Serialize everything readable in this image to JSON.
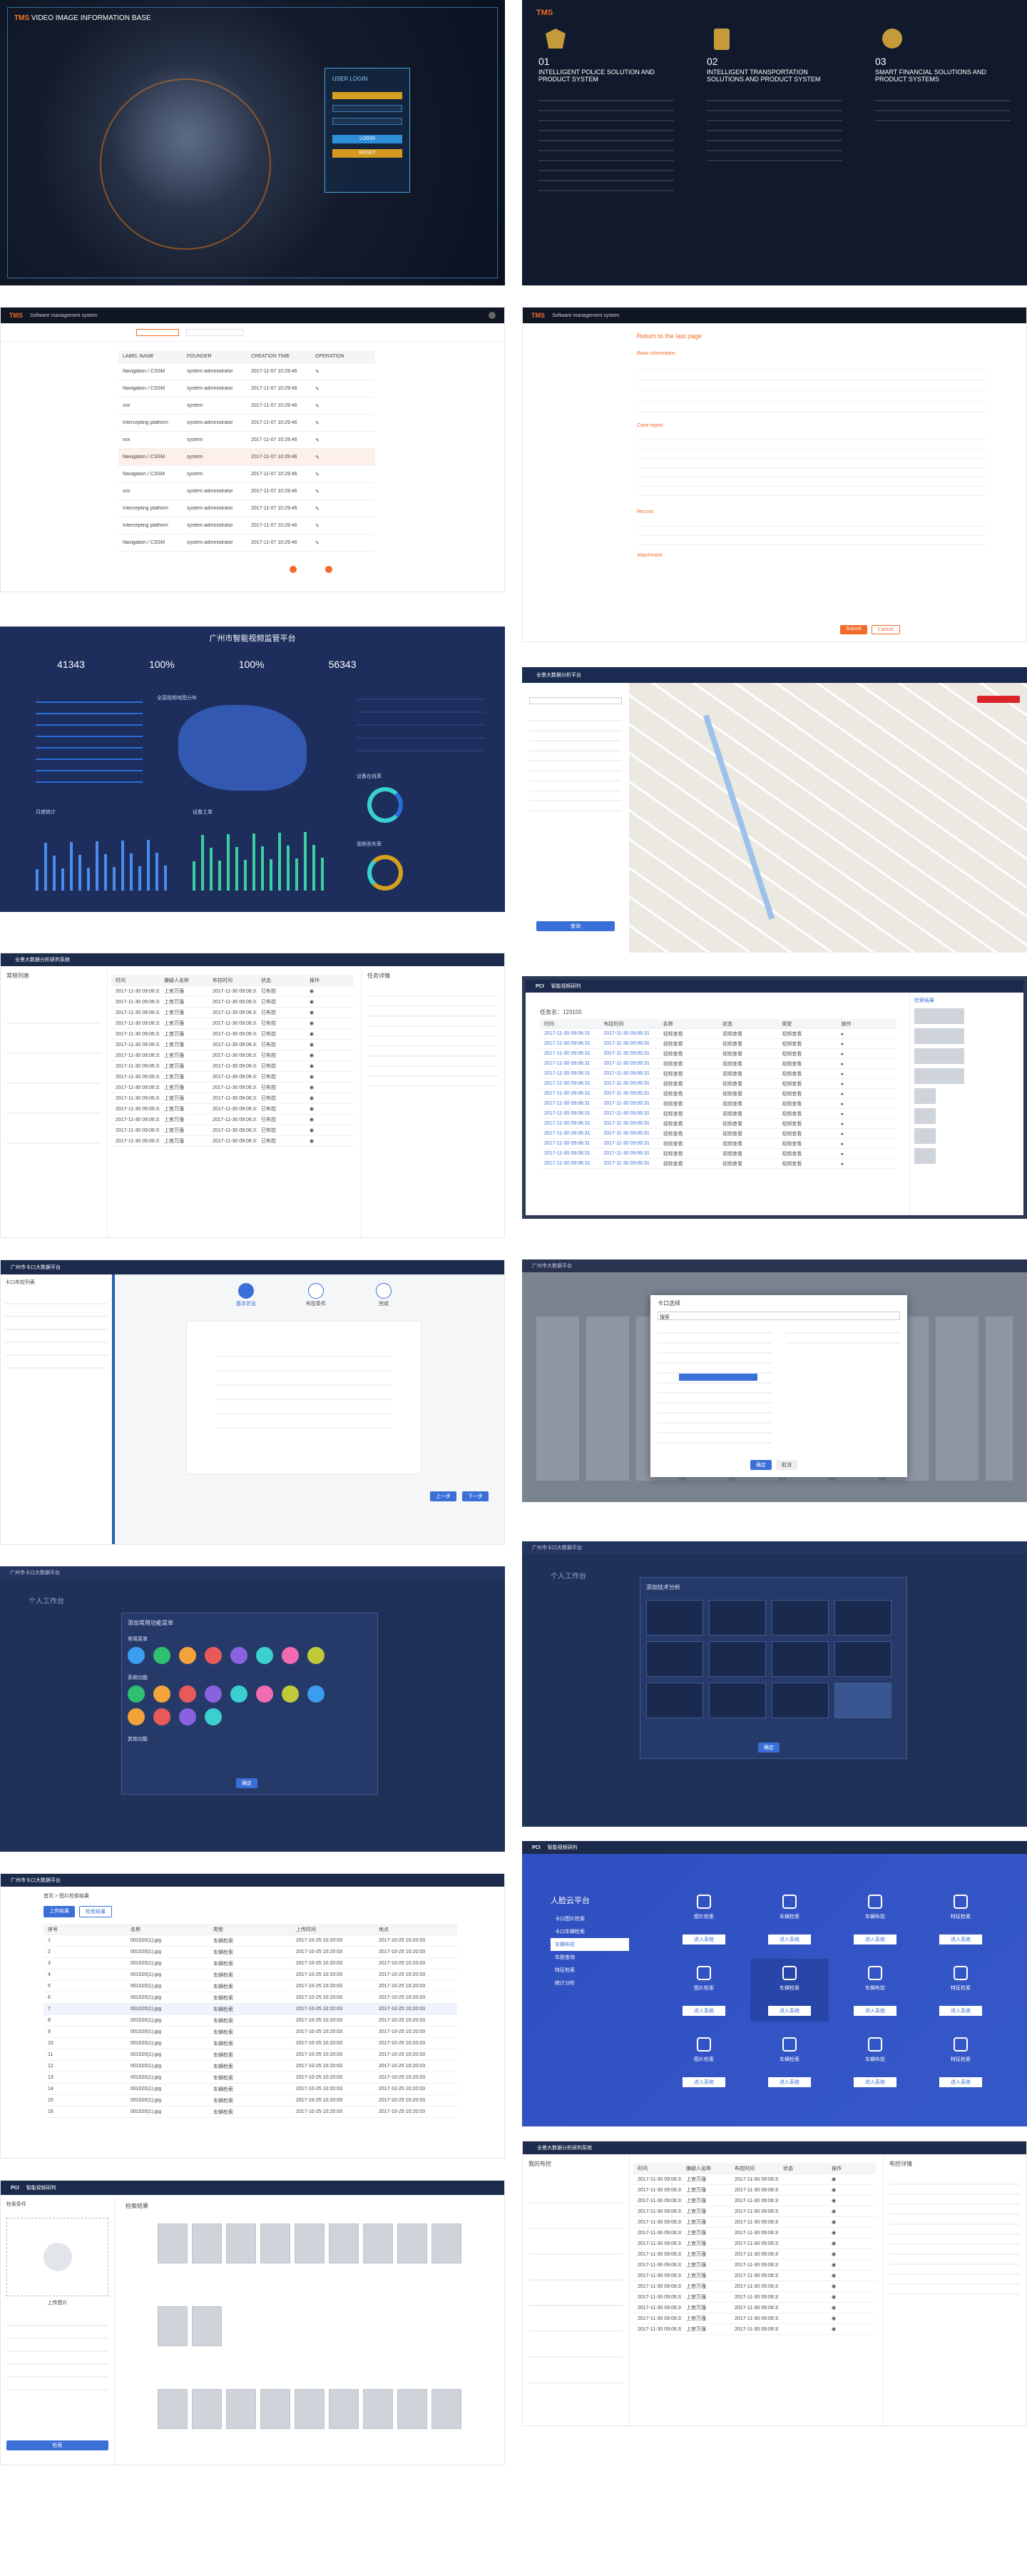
{
  "p1": {
    "brand": "TMS",
    "title": "VIDEO IMAGE INFORMATION BASE",
    "login_title": "USER LOGIN",
    "btn1": "LOGIN",
    "btn2": "RESET"
  },
  "p2": {
    "brand": "TMS",
    "num1": "01",
    "num2": "02",
    "num3": "03",
    "h1": "INTELLIGENT POLICE SOLUTION AND PRODUCT SYSTEM",
    "h2": "INTELLIGENT TRANSPORTATION SOLUTIONS AND PRODUCT SYSTEM",
    "h3": "SMART FINANCIAL SOLUTIONS AND PRODUCT SYSTEMS"
  },
  "p3": {
    "brand": "TMS",
    "app": "Software management system",
    "cols": [
      "LABEL NAME",
      "FOUNDER",
      "CREATION TIME",
      "OPERATION"
    ],
    "rows": [
      [
        "Navigation / CSSM",
        "system administrator",
        "2017-11-07 10:29:46"
      ],
      [
        "Navigation / CSSM",
        "system administrator",
        "2017-11-07 10:29:46"
      ],
      [
        "xxx",
        "system",
        "2017-11-07 10:29:46"
      ],
      [
        "Intercepting platform",
        "system administrator",
        "2017-11-07 10:29:46"
      ],
      [
        "xxx",
        "system",
        "2017-11-07 10:29:46"
      ],
      [
        "Navigation / CSSM",
        "system",
        "2017-11-07 10:29:46"
      ],
      [
        "Navigation / CSSM",
        "system",
        "2017-11-07 10:29:46"
      ],
      [
        "xxx",
        "system administrator",
        "2017-11-07 10:29:46"
      ],
      [
        "Intercepting platform",
        "system administrator",
        "2017-11-07 10:29:46"
      ],
      [
        "Intercepting platform",
        "system administrator",
        "2017-11-07 10:29:46"
      ],
      [
        "Navigation / CSSM",
        "system administrator",
        "2017-11-07 10:29:46"
      ]
    ]
  },
  "p4": {
    "brand": "TMS",
    "app": "Software management system",
    "heading": "Return to the last page",
    "sec1": "Basic information",
    "sec2": "Case report",
    "sec3": "Record",
    "sec4": "Attachment",
    "btn1": "Submit",
    "btn2": "Cancel"
  },
  "p5": {
    "title": "广州市智能视频监管平台",
    "s1": "41343",
    "s2": "100%",
    "s3": "100%",
    "s4": "56343",
    "map": "全国视频地图分布",
    "chart1": "月度统计",
    "chart2": "设备工单",
    "pie1": "设备在线率",
    "pie2": "视频丢失率"
  },
  "p6": {
    "app": "全景大数据分析平台",
    "search": "搜索",
    "btn": "查询"
  },
  "p7": {
    "app": "全景大数据分析研判系统",
    "list_title": "常规列表",
    "panel": "任务详情",
    "cols": [
      "时间",
      "嫌疑人名称",
      "布控时间",
      "状态",
      "操作"
    ],
    "row_time": "2017-11-30 09:06:31",
    "row_name": "上官万强",
    "row_status": "已布控"
  },
  "p8": {
    "brand": "PCI",
    "app": "智能视频研判",
    "title": "任务名：123155",
    "cols": [
      "时间",
      "布控时间",
      "名称",
      "状态",
      "类型",
      "操作"
    ],
    "row_time": "2017-11-30 09:06:31",
    "row_name": "视频查看",
    "right_title": "检索结果"
  },
  "p9": {
    "app": "广州市卡口大数据平台",
    "step1": "基本信息",
    "step2": "布控条件",
    "step3": "完成",
    "side": "卡口布控列表",
    "btn1": "上一步",
    "btn2": "下一步"
  },
  "p10": {
    "app": "广州市大数据平台",
    "modal_title": "卡口选择",
    "search": "搜索",
    "ok": "确定",
    "cancel": "取消"
  },
  "p11": {
    "app": "广州市卡口大数据平台",
    "bg": "个人工作台",
    "modal_title": "添加常用功能菜单",
    "g1": "常用菜单",
    "g2": "系统功能",
    "g3": "其他功能",
    "ok": "确定"
  },
  "p12": {
    "app": "广州市卡口大数据平台",
    "bg": "个人工作台",
    "modal_title": "添加技术分析",
    "ok": "确定"
  },
  "p13": {
    "app": "广州市卡口大数据平台",
    "crumb": "首页 > 图片检索结果",
    "tab1": "上传结果",
    "tab2": "检索结果",
    "cols": [
      "序号",
      "名称",
      "类型",
      "上传时间",
      "地点"
    ],
    "fname": "001020(1).jpg",
    "ftype": "车辆检索",
    "ftime": "2017-10-25 10:20:03"
  },
  "p14": {
    "brand": "PCI",
    "app": "智能视频研判",
    "title": "人脸云平台",
    "menu": [
      "卡口图片检索",
      "卡口车辆检索",
      "车辆布控",
      "车脸查询",
      "特征检索",
      "统计分析"
    ],
    "tiles": [
      "图片检索",
      "车辆检索",
      "车辆布控",
      "特征检索",
      "图片检索",
      "车辆检索",
      "车辆布控",
      "特征检索",
      "图片检索",
      "车辆检索",
      "车辆布控",
      "特征检索"
    ],
    "btn": "进入系统"
  },
  "p15": {
    "brand": "PCI",
    "app": "智能视频研判",
    "side": "检索条件",
    "upload": "上传图片",
    "result": "检索结果",
    "btn": "检索"
  },
  "p16": {
    "app": "全景大数据分析研判系统",
    "list": "我的布控",
    "panel": "布控详情",
    "cols": [
      "时间",
      "嫌疑人名称",
      "布控时间",
      "状态",
      "操作"
    ],
    "row_time": "2017-11-30 09:06:31",
    "row_name": "上官万强"
  },
  "colors": {
    "accent": "#3b6fd8",
    "orange": "#f26b2a",
    "navy": "#1c2a4c",
    "dark": "#0f1729"
  }
}
